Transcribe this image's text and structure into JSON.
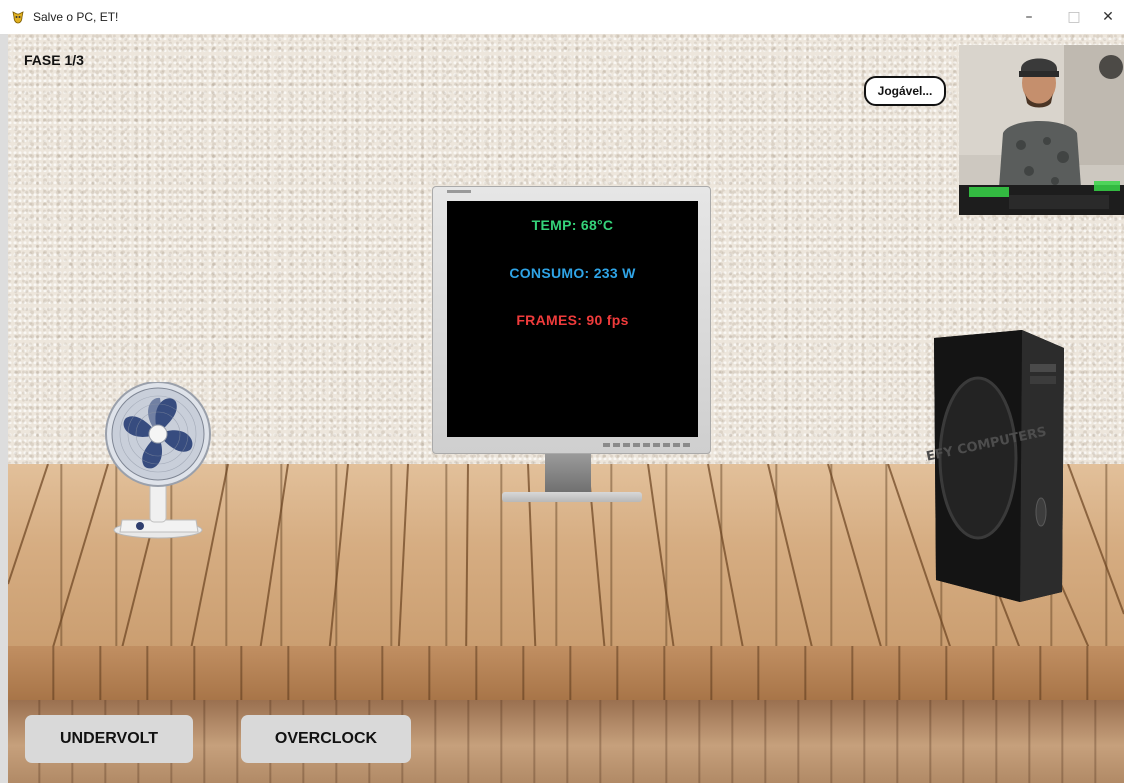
{
  "window": {
    "title": "Salve o PC, ET!",
    "minimize_glyph": "–",
    "maximize_glyph": "□",
    "close_glyph": "✕"
  },
  "hud": {
    "phase": "FASE 1/3",
    "bubble_text": "Jogável..."
  },
  "monitor": {
    "temp": "TEMP: 68°C",
    "power": "CONSUMO: 233 W",
    "frames": "FRAMES: 90 fps",
    "temp_color": "#35d37a",
    "power_color": "#2fa4e6",
    "frames_color": "#ef3b3b"
  },
  "tower": {
    "brand": "BEEFY COMPUTERS"
  },
  "controls": {
    "undervolt_label": "UNDERVOLT",
    "overclock_label": "OVERCLOCK"
  },
  "icons": [
    "app-icon",
    "fan-icon",
    "pc-tower-icon",
    "monitor-icon",
    "webcam-feed"
  ]
}
